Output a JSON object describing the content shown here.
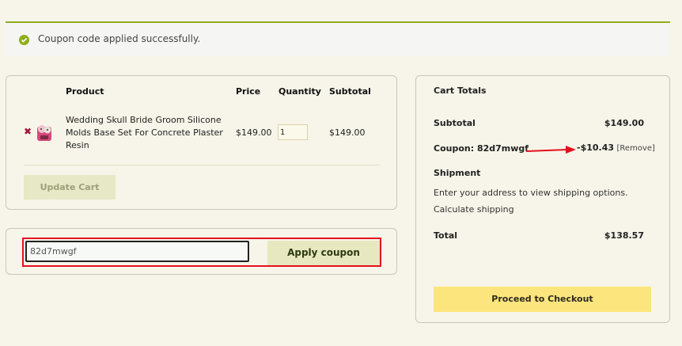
{
  "notice": {
    "message": "Coupon code applied successfully.",
    "color": "#8fae1b"
  },
  "cart": {
    "headers": {
      "product": "Product",
      "price": "Price",
      "quantity": "Quantity",
      "subtotal": "Subtotal"
    },
    "items": [
      {
        "name": "Wedding Skull Bride Groom Silicone Molds Base Set For Concrete Plaster Resin",
        "price": "$149.00",
        "quantity": "1",
        "subtotal": "$149.00"
      }
    ],
    "update_label": "Update Cart"
  },
  "coupon": {
    "code_value": "82d7mwgf",
    "apply_label": "Apply coupon"
  },
  "totals": {
    "title": "Cart Totals",
    "subtotal_label": "Subtotal",
    "subtotal_value": "$149.00",
    "coupon_label": "Coupon: 82d7mwgf",
    "coupon_amount": "-$10.43",
    "coupon_remove": "[Remove]",
    "shipment_label": "Shipment",
    "shipment_text": "Enter your address to view shipping options.",
    "calculate_label": "Calculate shipping",
    "total_label": "Total",
    "total_value": "$138.57",
    "checkout_label": "Proceed to Checkout"
  },
  "colors": {
    "accent_red": "#e3101f",
    "checkout_yellow": "#fde57d",
    "background": "#f7f5e9"
  }
}
